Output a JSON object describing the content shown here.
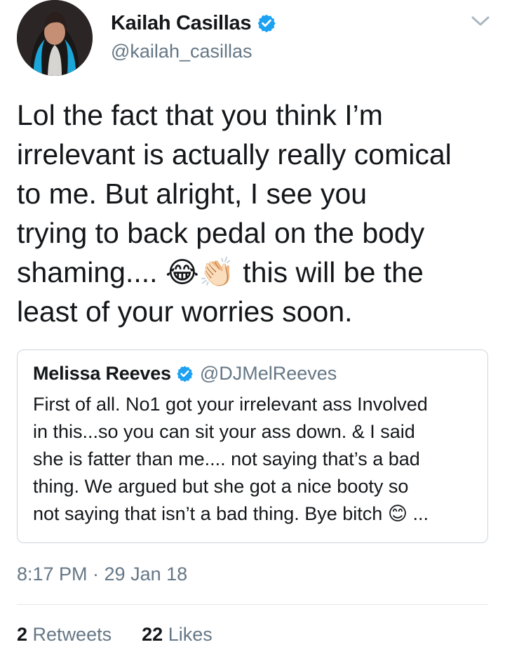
{
  "tweet": {
    "author": {
      "name": "Kailah Casillas",
      "handle": "@kailah_casillas",
      "verified_icon": "verified-badge-icon",
      "avatar": "profile-photo"
    },
    "menu_icon": "chevron-down-icon",
    "text": "Lol the fact that you think I’m\nirrelevant is actually really comical\nto me. But alright, I see you\ntrying to back pedal on the body\nshaming.... 😂👏🏻 this will be the\nleast of your worries soon.",
    "quoted": {
      "name": "Melissa Reeves",
      "handle": "@DJMelReeves",
      "verified_icon": "verified-badge-icon",
      "text": "First of all. No1 got your irrelevant ass Involved\nin this...so you can sit your ass down. & I said\nshe is fatter than me.... not saying that’s a bad\nthing. We argued but she got a nice booty so\nnot saying that isn’t a bad thing. Bye bitch 😊 ..."
    },
    "timestamp": "8:17 PM · 29 Jan 18",
    "stats": {
      "retweets_count": "2",
      "retweets_label": "Retweets",
      "likes_count": "22",
      "likes_label": "Likes"
    }
  },
  "colors": {
    "primary_text": "#14171a",
    "secondary_text": "#657786",
    "verified_blue": "#1da1f2",
    "border": "#ccd6dd",
    "divider": "#e1e8ed",
    "background": "#ffffff"
  }
}
